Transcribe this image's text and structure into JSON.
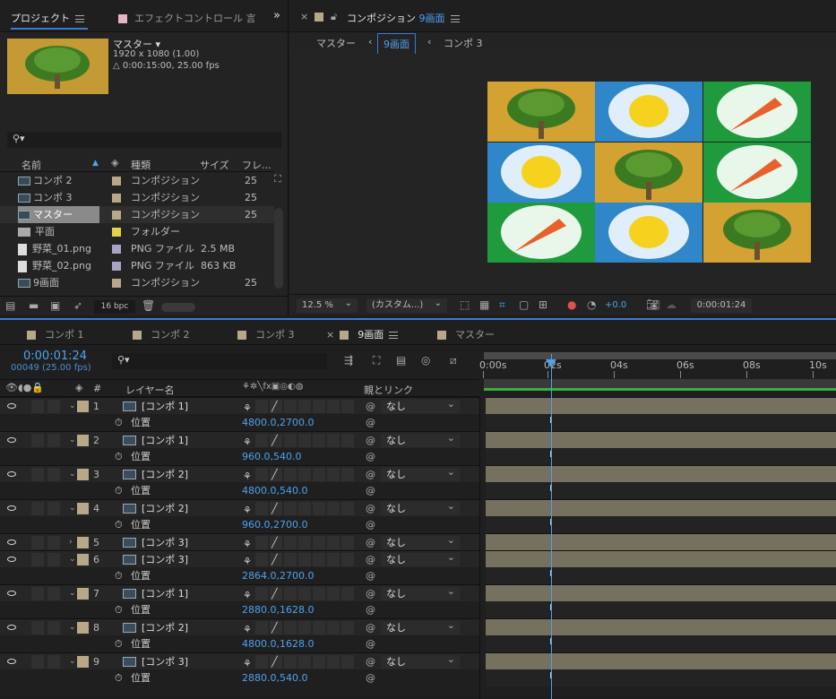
{
  "project": {
    "tab_project": "プロジェクト",
    "tab_effects": "エフェクトコントロール 言",
    "preview": {
      "name": "マスター ▾",
      "dims": "1920 x 1080 (1.00)",
      "duration": "△ 0:00:15:00, 25.00 fps"
    },
    "search_placeholder": "",
    "headers": {
      "name": "名前",
      "type": "種類",
      "size": "サイズ",
      "frame": "フレ..."
    },
    "items": [
      {
        "name": "コンポ 2",
        "type": "コンポジション",
        "size": "",
        "fr": "25",
        "color": "#b8a88a",
        "kind": "comp"
      },
      {
        "name": "コンポ 3",
        "type": "コンポジション",
        "size": "",
        "fr": "25",
        "color": "#b8a88a",
        "kind": "comp"
      },
      {
        "name": "マスター",
        "type": "コンポジション",
        "size": "",
        "fr": "25",
        "color": "#b8a88a",
        "kind": "comp"
      },
      {
        "name": "平面",
        "type": "フォルダー",
        "size": "",
        "fr": "",
        "color": "#e2d24a",
        "kind": "folder"
      },
      {
        "name": "野菜_01.png",
        "type": "PNG ファイル",
        "size": "2.5 MB",
        "fr": "",
        "color": "#a9a3c9",
        "kind": "file"
      },
      {
        "name": "野菜_02.png",
        "type": "PNG ファイル",
        "size": "863 KB",
        "fr": "",
        "color": "#a9a3c9",
        "kind": "file"
      },
      {
        "name": "9画面",
        "type": "コンポジション",
        "size": "",
        "fr": "25",
        "color": "#b8a88a",
        "kind": "comp"
      }
    ],
    "bpc": "16 bpc"
  },
  "comp": {
    "title_prefix": "コンポジション",
    "title_name": "9画面",
    "crumbs": [
      "マスター",
      "9画面",
      "コンポ 3"
    ],
    "zoom": "12.5 %",
    "res": "(カスタム...)",
    "exposure": "+0.0",
    "timecode": "0:00:01:24",
    "grid": [
      "tree",
      "lemon",
      "carrot",
      "lemon",
      "tree",
      "carrot",
      "carrot",
      "lemon",
      "tree"
    ]
  },
  "timeline": {
    "tabs": [
      "コンポ 1",
      "コンポ 2",
      "コンポ 3",
      "9画面",
      "マスター"
    ],
    "timecode": "0:00:01:24",
    "frames": "00049 (25.00 fps)",
    "col_layer": "レイヤー名",
    "col_parent": "親とリンク",
    "ruler": [
      "0:00s",
      "02s",
      "04s",
      "06s",
      "08s",
      "10s"
    ],
    "position_label": "位置",
    "layers": [
      {
        "n": "1",
        "name": "[コンポ 1]",
        "pos": "4800.0,2700.0",
        "parent": "なし",
        "open": true
      },
      {
        "n": "2",
        "name": "[コンポ 1]",
        "pos": "960.0,540.0",
        "parent": "なし",
        "open": true
      },
      {
        "n": "3",
        "name": "[コンポ 2]",
        "pos": "4800.0,540.0",
        "parent": "なし",
        "open": true
      },
      {
        "n": "4",
        "name": "[コンポ 2]",
        "pos": "960.0,2700.0",
        "parent": "なし",
        "open": true
      },
      {
        "n": "5",
        "name": "[コンポ 3]",
        "pos": "",
        "parent": "なし",
        "open": false
      },
      {
        "n": "6",
        "name": "[コンポ 3]",
        "pos": "2864.0,2700.0",
        "parent": "なし",
        "open": true
      },
      {
        "n": "7",
        "name": "[コンポ 1]",
        "pos": "2880.0,1628.0",
        "parent": "なし",
        "open": true
      },
      {
        "n": "8",
        "name": "[コンポ 2]",
        "pos": "4800.0,1628.0",
        "parent": "なし",
        "open": true
      },
      {
        "n": "9",
        "name": "[コンポ 3]",
        "pos": "2880.0,540.0",
        "parent": "なし",
        "open": true
      }
    ]
  }
}
